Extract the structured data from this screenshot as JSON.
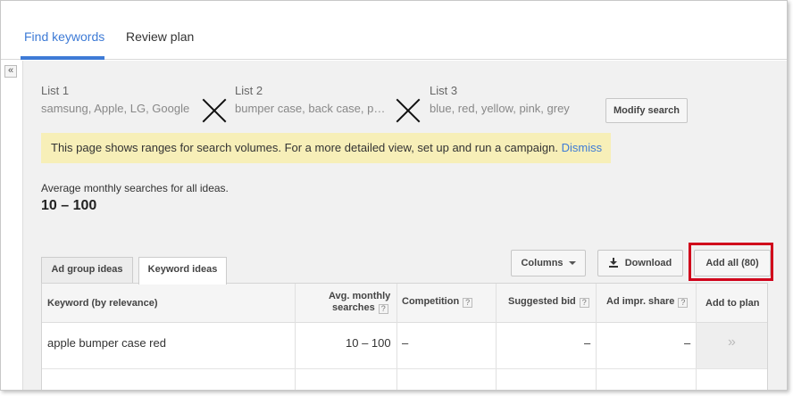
{
  "top_tabs": {
    "find_keywords": "Find keywords",
    "review_plan": "Review plan"
  },
  "collapse_glyph": "«",
  "lists": [
    {
      "title": "List 1",
      "items": "samsung, Apple, LG, Google"
    },
    {
      "title": "List 2",
      "items": "bumper case, back case, p…"
    },
    {
      "title": "List 3",
      "items": "blue, red, yellow, pink, grey"
    }
  ],
  "modify_search": "Modify search",
  "notice": {
    "text": "This page shows ranges for search volumes. For a more detailed view, set up and run a campaign.",
    "dismiss": "Dismiss"
  },
  "average": {
    "label": "Average monthly searches for all ideas.",
    "value": "10 – 100"
  },
  "sub_tabs": {
    "ad_group_ideas": "Ad group ideas",
    "keyword_ideas": "Keyword ideas"
  },
  "toolbar": {
    "columns": "Columns",
    "download": "Download",
    "add_all": "Add all (80)"
  },
  "table": {
    "headers": {
      "keyword": "Keyword (by relevance)",
      "avg_line1": "Avg. monthly",
      "avg_line2": "searches",
      "competition": "Competition",
      "suggested_bid": "Suggested bid",
      "ad_impr_share": "Ad impr. share",
      "add_to_plan": "Add to plan"
    },
    "help_glyph": "?",
    "rows": [
      {
        "keyword": "apple bumper case red",
        "avg": "10 – 100",
        "competition": "–",
        "suggested_bid": "–",
        "ad_impr_share": "–",
        "add": "»"
      }
    ]
  },
  "colors": {
    "link": "#3e7bd6",
    "notice_bg": "#f7efb8",
    "highlight": "#d0021b"
  }
}
